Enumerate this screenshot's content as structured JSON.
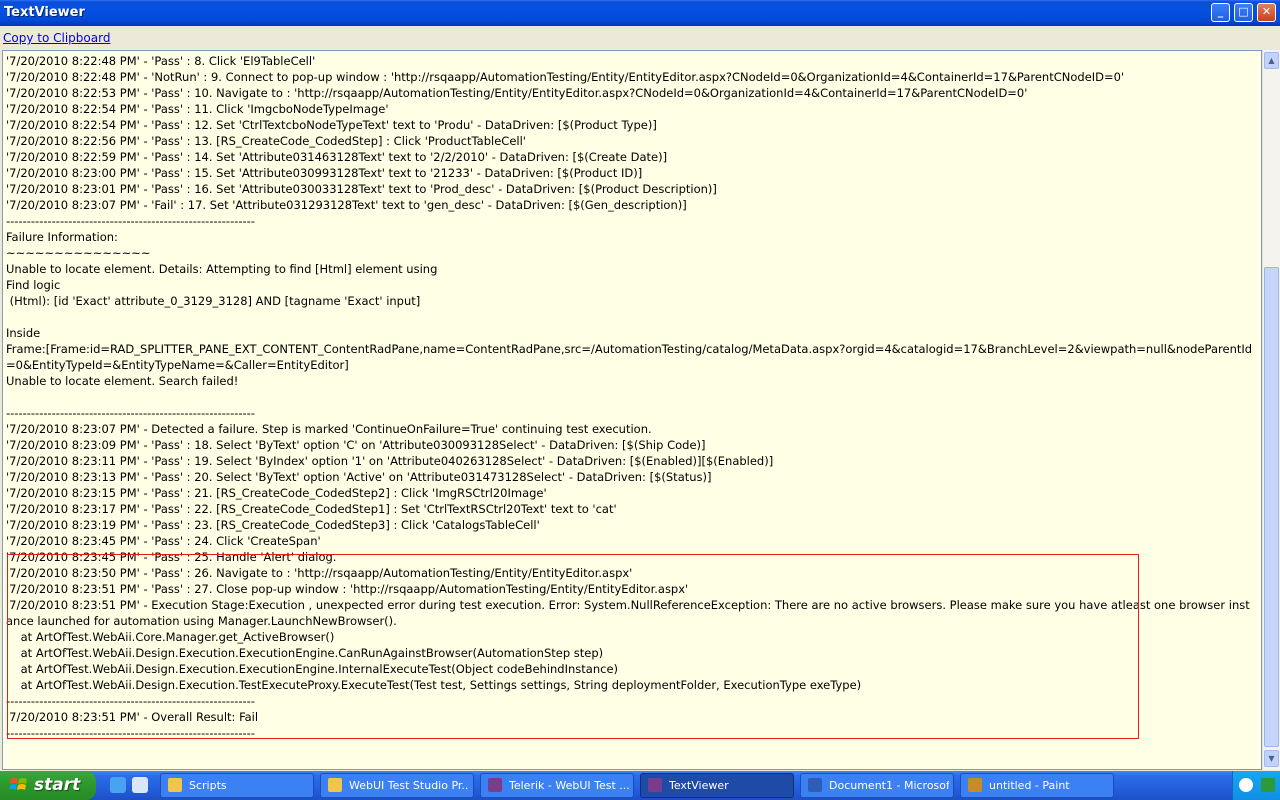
{
  "window": {
    "title": "TextViewer",
    "minimize": "_",
    "maximize": "□",
    "close": "✕"
  },
  "toolbar": {
    "copy_link": "Copy to Clipboard"
  },
  "log_lines": [
    "'7/20/2010 8:22:48 PM' - 'Pass' : 8. Click 'El9TableCell'",
    "'7/20/2010 8:22:48 PM' - 'NotRun' : 9. Connect to pop-up window : 'http://rsqaapp/AutomationTesting/Entity/EntityEditor.aspx?CNodeId=0&OrganizationId=4&ContainerId=17&ParentCNodeID=0'",
    "'7/20/2010 8:22:53 PM' - 'Pass' : 10. Navigate to : 'http://rsqaapp/AutomationTesting/Entity/EntityEditor.aspx?CNodeId=0&OrganizationId=4&ContainerId=17&ParentCNodeID=0'",
    "'7/20/2010 8:22:54 PM' - 'Pass' : 11. Click 'ImgcboNodeTypeImage'",
    "'7/20/2010 8:22:54 PM' - 'Pass' : 12. Set 'CtrlTextcboNodeTypeText' text to 'Produ' - DataDriven: [$(Product Type)]",
    "'7/20/2010 8:22:56 PM' - 'Pass' : 13. [RS_CreateCode_CodedStep] : Click 'ProductTableCell'",
    "'7/20/2010 8:22:59 PM' - 'Pass' : 14. Set 'Attribute031463128Text' text to '2/2/2010' - DataDriven: [$(Create Date)]",
    "'7/20/2010 8:23:00 PM' - 'Pass' : 15. Set 'Attribute030993128Text' text to '21233' - DataDriven: [$(Product ID)]",
    "'7/20/2010 8:23:01 PM' - 'Pass' : 16. Set 'Attribute030033128Text' text to 'Prod_desc' - DataDriven: [$(Product Description)]",
    "'7/20/2010 8:23:07 PM' - 'Fail' : 17. Set 'Attribute031293128Text' text to 'gen_desc' - DataDriven: [$(Gen_description)]",
    "------------------------------------------------------------",
    "Failure Information:",
    "~~~~~~~~~~~~~~~",
    "Unable to locate element. Details: Attempting to find [Html] element using",
    "Find logic",
    " (Html): [id 'Exact' attribute_0_3129_3128] AND [tagname 'Exact' input]",
    "",
    "Inside",
    "Frame:[Frame:id=RAD_SPLITTER_PANE_EXT_CONTENT_ContentRadPane,name=ContentRadPane,src=/AutomationTesting/catalog/MetaData.aspx?orgid=4&catalogid=17&BranchLevel=2&viewpath=null&nodeParentId=0&EntityTypeId=&EntityTypeName=&Caller=EntityEditor]",
    "Unable to locate element. Search failed!",
    "",
    "------------------------------------------------------------",
    "'7/20/2010 8:23:07 PM' - Detected a failure. Step is marked 'ContinueOnFailure=True' continuing test execution.",
    "'7/20/2010 8:23:09 PM' - 'Pass' : 18. Select 'ByText' option 'C' on 'Attribute030093128Select' - DataDriven: [$(Ship Code)]",
    "'7/20/2010 8:23:11 PM' - 'Pass' : 19. Select 'ByIndex' option '1' on 'Attribute040263128Select' - DataDriven: [$(Enabled)][$(Enabled)]",
    "'7/20/2010 8:23:13 PM' - 'Pass' : 20. Select 'ByText' option 'Active' on 'Attribute031473128Select' - DataDriven: [$(Status)]",
    "'7/20/2010 8:23:15 PM' - 'Pass' : 21. [RS_CreateCode_CodedStep2] : Click 'ImgRSCtrl20Image'",
    "'7/20/2010 8:23:17 PM' - 'Pass' : 22. [RS_CreateCode_CodedStep1] : Set 'CtrlTextRSCtrl20Text' text to 'cat'",
    "'7/20/2010 8:23:19 PM' - 'Pass' : 23. [RS_CreateCode_CodedStep3] : Click 'CatalogsTableCell'",
    "'7/20/2010 8:23:45 PM' - 'Pass' : 24. Click 'CreateSpan'",
    "'7/20/2010 8:23:45 PM' - 'Pass' : 25. Handle 'Alert' dialog.",
    "'7/20/2010 8:23:50 PM' - 'Pass' : 26. Navigate to : 'http://rsqaapp/AutomationTesting/Entity/EntityEditor.aspx'",
    "'7/20/2010 8:23:51 PM' - 'Pass' : 27. Close pop-up window : 'http://rsqaapp/AutomationTesting/Entity/EntityEditor.aspx'",
    "'7/20/2010 8:23:51 PM' - Execution Stage:Execution , unexpected error during test execution. Error: System.NullReferenceException: There are no active browsers. Please make sure you have atleast one browser instance launched for automation using Manager.LaunchNewBrowser().",
    "    at ArtOfTest.WebAii.Core.Manager.get_ActiveBrowser()",
    "    at ArtOfTest.WebAii.Design.Execution.ExecutionEngine.CanRunAgainstBrowser(AutomationStep step)",
    "    at ArtOfTest.WebAii.Design.Execution.ExecutionEngine.InternalExecuteTest(Object codeBehindInstance)",
    "    at ArtOfTest.WebAii.Design.Execution.TestExecuteProxy.ExecuteTest(Test test, Settings settings, String deploymentFolder, ExecutionType exeType)",
    "------------------------------------------------------------",
    "'7/20/2010 8:23:51 PM' - Overall Result: Fail",
    "------------------------------------------------------------"
  ],
  "taskbar": {
    "start_label": "start",
    "tasks": [
      {
        "label": "Scripts",
        "icon": "folder-icon",
        "color": "#f3c44c"
      },
      {
        "label": "WebUI Test Studio Pr...",
        "icon": "folder-icon",
        "color": "#f3c44c"
      },
      {
        "label": "Telerik - WebUI Test ...",
        "icon": "app-icon",
        "color": "#7a3d8c"
      },
      {
        "label": "TextViewer",
        "icon": "app-icon",
        "color": "#7a3d8c"
      },
      {
        "label": "Document1 - Microsof...",
        "icon": "word-icon",
        "color": "#2d5db5"
      },
      {
        "label": "untitled - Paint",
        "icon": "paint-icon",
        "color": "#c98a2a"
      }
    ]
  }
}
